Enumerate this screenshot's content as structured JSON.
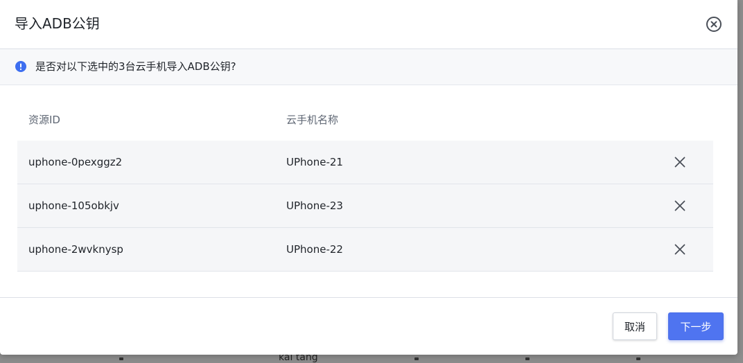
{
  "dialog": {
    "title": "导入ADB公钥",
    "notice": "是否对以下选中的3台云手机导入ADB公钥?"
  },
  "table": {
    "columns": [
      "资源ID",
      "云手机名称"
    ],
    "rows": [
      {
        "id": "uphone-0pexggz2",
        "name": "UPhone-21"
      },
      {
        "id": "uphone-105obkjv",
        "name": "UPhone-23"
      },
      {
        "id": "uphone-2wvknysp",
        "name": "UPhone-22"
      }
    ]
  },
  "footer": {
    "cancel_label": "取消",
    "next_label": "下一步"
  },
  "background": {
    "partial_text": "kai tang"
  },
  "colors": {
    "primary": "#4f74f0",
    "info_icon": "#3d6ef0",
    "row_background": "#f5f6f8"
  },
  "icons": {
    "close": "circle-x-icon",
    "notice": "info-circle-icon",
    "row_remove": "x-icon"
  }
}
